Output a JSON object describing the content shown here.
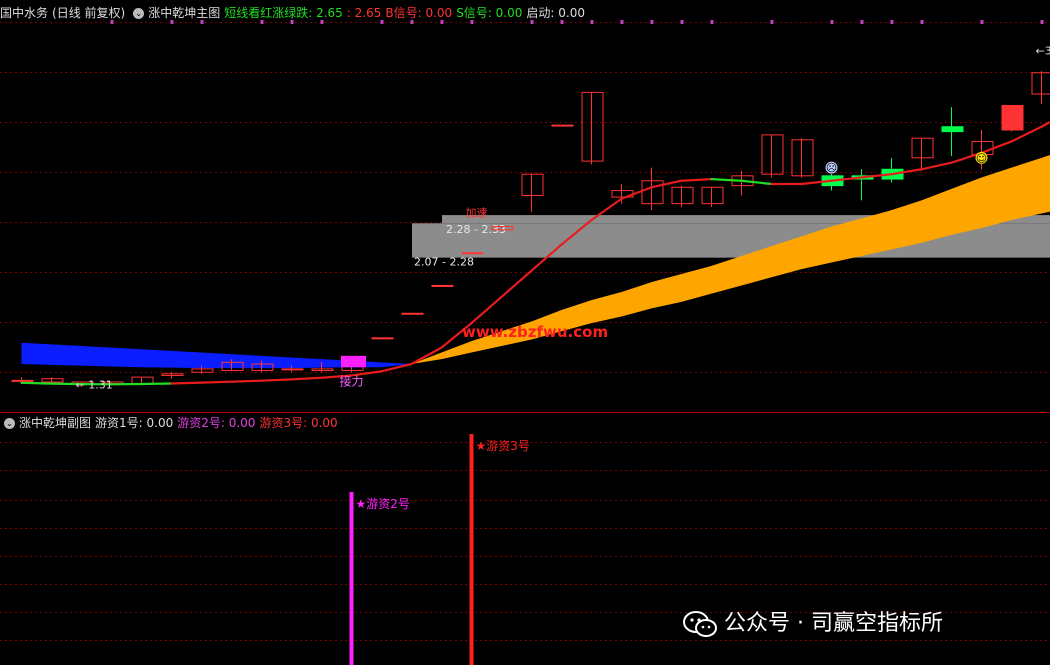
{
  "main_header": {
    "stock_name": "国中水务",
    "period": "(日线 前复权)",
    "indicator_name": "涨中乾坤主图",
    "legend_label": "短线看红涨绿跌: 2.65",
    "legend_value2": ": 2.65",
    "b_signal": "B信号: 0.00",
    "s_signal": "S信号: 0.00",
    "start": "启动: 0.00"
  },
  "sub_header": {
    "indicator_name": "涨中乾坤副图",
    "s1": "游资1号: 0.00",
    "s2": "游资2号: 0.00",
    "s3": "游资3号: 0.00"
  },
  "colors": {
    "up": "#ff3333",
    "down": "#00ff4c",
    "ma_up": "#e81c1c",
    "ma_down": "#22dd22",
    "blue_band": "#0a1eff",
    "orange_band": "#ffa500",
    "gray_band": "#8c8c8c",
    "magenta": "#ff20ff",
    "red_bar": "#ff2020",
    "grid": "#7a0000"
  },
  "watermark": {
    "site": "www.zbzfwu.com",
    "account": "公众号 · 司赢空指标所"
  },
  "chart_data": [
    {
      "type": "candlestick",
      "title": "涨中乾坤主图",
      "ylim": [
        1.2,
        3.4
      ],
      "candles": [
        {
          "o": 1.32,
          "h": 1.34,
          "l": 1.3,
          "c": 1.32
        },
        {
          "o": 1.33,
          "h": 1.34,
          "l": 1.3,
          "c": 1.31
        },
        {
          "o": 1.31,
          "h": 1.31,
          "l": 1.28,
          "c": 1.3
        },
        {
          "o": 1.3,
          "h": 1.31,
          "l": 1.29,
          "c": 1.31
        },
        {
          "o": 1.3,
          "h": 1.34,
          "l": 1.29,
          "c": 1.34
        },
        {
          "o": 1.35,
          "h": 1.37,
          "l": 1.33,
          "c": 1.36
        },
        {
          "o": 1.37,
          "h": 1.41,
          "l": 1.36,
          "c": 1.39
        },
        {
          "o": 1.43,
          "h": 1.45,
          "l": 1.38,
          "c": 1.38
        },
        {
          "o": 1.42,
          "h": 1.44,
          "l": 1.37,
          "c": 1.38
        },
        {
          "o": 1.39,
          "h": 1.41,
          "l": 1.37,
          "c": 1.39
        },
        {
          "o": 1.39,
          "h": 1.43,
          "l": 1.37,
          "c": 1.38
        },
        {
          "o": 1.38,
          "h": 1.45,
          "l": 1.37,
          "c": 1.44
        },
        {
          "o": 1.58,
          "h": 1.58,
          "l": 1.58,
          "c": 1.58
        },
        {
          "o": 1.73,
          "h": 1.73,
          "l": 1.73,
          "c": 1.73
        },
        {
          "o": 1.9,
          "h": 1.9,
          "l": 1.9,
          "c": 1.9
        },
        {
          "o": 2.1,
          "h": 2.1,
          "l": 2.1,
          "c": 2.1
        },
        {
          "o": 2.24,
          "h": 2.26,
          "l": 2.24,
          "c": 2.26
        },
        {
          "o": 2.45,
          "h": 2.58,
          "l": 2.35,
          "c": 2.58
        },
        {
          "o": 2.88,
          "h": 2.88,
          "l": 2.88,
          "c": 2.88
        },
        {
          "o": 2.66,
          "h": 3.08,
          "l": 2.64,
          "c": 3.08
        },
        {
          "o": 2.44,
          "h": 2.52,
          "l": 2.4,
          "c": 2.48
        },
        {
          "o": 2.4,
          "h": 2.62,
          "l": 2.36,
          "c": 2.54
        },
        {
          "o": 2.4,
          "h": 2.51,
          "l": 2.38,
          "c": 2.5
        },
        {
          "o": 2.4,
          "h": 2.5,
          "l": 2.38,
          "c": 2.5
        },
        {
          "o": 2.51,
          "h": 2.6,
          "l": 2.45,
          "c": 2.57
        },
        {
          "o": 2.58,
          "h": 2.82,
          "l": 2.56,
          "c": 2.82
        },
        {
          "o": 2.57,
          "h": 2.8,
          "l": 2.56,
          "c": 2.79
        },
        {
          "o": 2.51,
          "h": 2.58,
          "l": 2.48,
          "c": 2.57
        },
        {
          "o": 2.57,
          "h": 2.61,
          "l": 2.42,
          "c": 2.55
        },
        {
          "o": 2.61,
          "h": 2.68,
          "l": 2.53,
          "c": 2.55
        },
        {
          "o": 2.68,
          "h": 2.8,
          "l": 2.6,
          "c": 2.8
        },
        {
          "o": 2.84,
          "h": 2.99,
          "l": 2.69,
          "c": 2.87
        },
        {
          "o": 2.7,
          "h": 2.85,
          "l": 2.61,
          "c": 2.78
        },
        {
          "o": 2.85,
          "h": 3.0,
          "l": 2.84,
          "c": 3.0
        },
        {
          "o": 3.07,
          "h": 3.21,
          "l": 3.01,
          "c": 3.2
        },
        {
          "o": 3.05,
          "h": 3.35,
          "l": 3.02,
          "c": 3.25
        }
      ],
      "ma": [
        1.305,
        1.3,
        1.297,
        1.296,
        1.298,
        1.301,
        1.306,
        1.312,
        1.318,
        1.326,
        1.336,
        1.35,
        1.375,
        1.42,
        1.52,
        1.67,
        1.83,
        1.99,
        2.15,
        2.3,
        2.43,
        2.5,
        2.54,
        2.55,
        2.54,
        2.52,
        2.52,
        2.54,
        2.56,
        2.58,
        2.61,
        2.65,
        2.71,
        2.78,
        2.87,
        2.97
      ],
      "ma_green_ranges": [
        [
          0,
          5
        ],
        [
          23,
          25
        ]
      ],
      "gray_zones": [
        {
          "low": 2.28,
          "high": 2.33,
          "label": "2.28 - 2.33"
        },
        {
          "low": 2.07,
          "high": 2.28,
          "label": "2.07 - 2.28"
        }
      ],
      "band_blue": {
        "from": 0,
        "to": 13,
        "upper": [
          1.55,
          1.54,
          1.53,
          1.52,
          1.51,
          1.5,
          1.49,
          1.48,
          1.47,
          1.46,
          1.45,
          1.44,
          1.43,
          1.42
        ],
        "lower": [
          1.42,
          1.415,
          1.41,
          1.405,
          1.4,
          1.398,
          1.395,
          1.395,
          1.395,
          1.395,
          1.398,
          1.4,
          1.4,
          1.42
        ]
      },
      "band_orange": {
        "from": 13,
        "to": 35,
        "upper": [
          1.42,
          1.49,
          1.56,
          1.62,
          1.68,
          1.75,
          1.81,
          1.86,
          1.92,
          1.97,
          2.02,
          2.08,
          2.14,
          2.2,
          2.26,
          2.31,
          2.36,
          2.42,
          2.49,
          2.56,
          2.62,
          2.68,
          2.74
        ],
        "lower": [
          1.42,
          1.45,
          1.49,
          1.53,
          1.57,
          1.62,
          1.67,
          1.71,
          1.76,
          1.8,
          1.85,
          1.9,
          1.95,
          2.0,
          2.04,
          2.08,
          2.12,
          2.16,
          2.21,
          2.25,
          2.3,
          2.34,
          2.38
        ]
      },
      "magenta_box": {
        "index": 11,
        "low": 1.4,
        "high": 1.47,
        "label": "接力"
      },
      "annotations": [
        {
          "text": "加速",
          "index": 15,
          "y": 2.32,
          "color": "#ff3333"
        },
        {
          "text": "← 1.31",
          "index": 2,
          "y": 1.27,
          "color": "#dddddd"
        },
        {
          "text": "←3",
          "index": 34,
          "y": 3.31,
          "color": "#dddddd"
        }
      ],
      "emoji": [
        {
          "index": 27,
          "y": 2.62,
          "glyph": "☹",
          "bg": "#b9c8ff"
        },
        {
          "index": 32,
          "y": 2.68,
          "glyph": "☺",
          "bg": "#ffe000"
        }
      ],
      "dots": [
        3,
        5,
        6,
        8,
        9,
        10,
        12,
        13,
        14,
        15,
        17,
        18,
        19,
        20,
        21,
        22,
        23,
        25,
        27,
        28,
        29,
        30,
        32,
        34,
        35
      ]
    },
    {
      "type": "bar",
      "title": "涨中乾坤副图",
      "series": [
        {
          "name": "游资2号",
          "index": 11,
          "color": "#ff20ff"
        },
        {
          "name": "游资3号",
          "index": 15,
          "color": "#ff2020"
        }
      ]
    }
  ]
}
